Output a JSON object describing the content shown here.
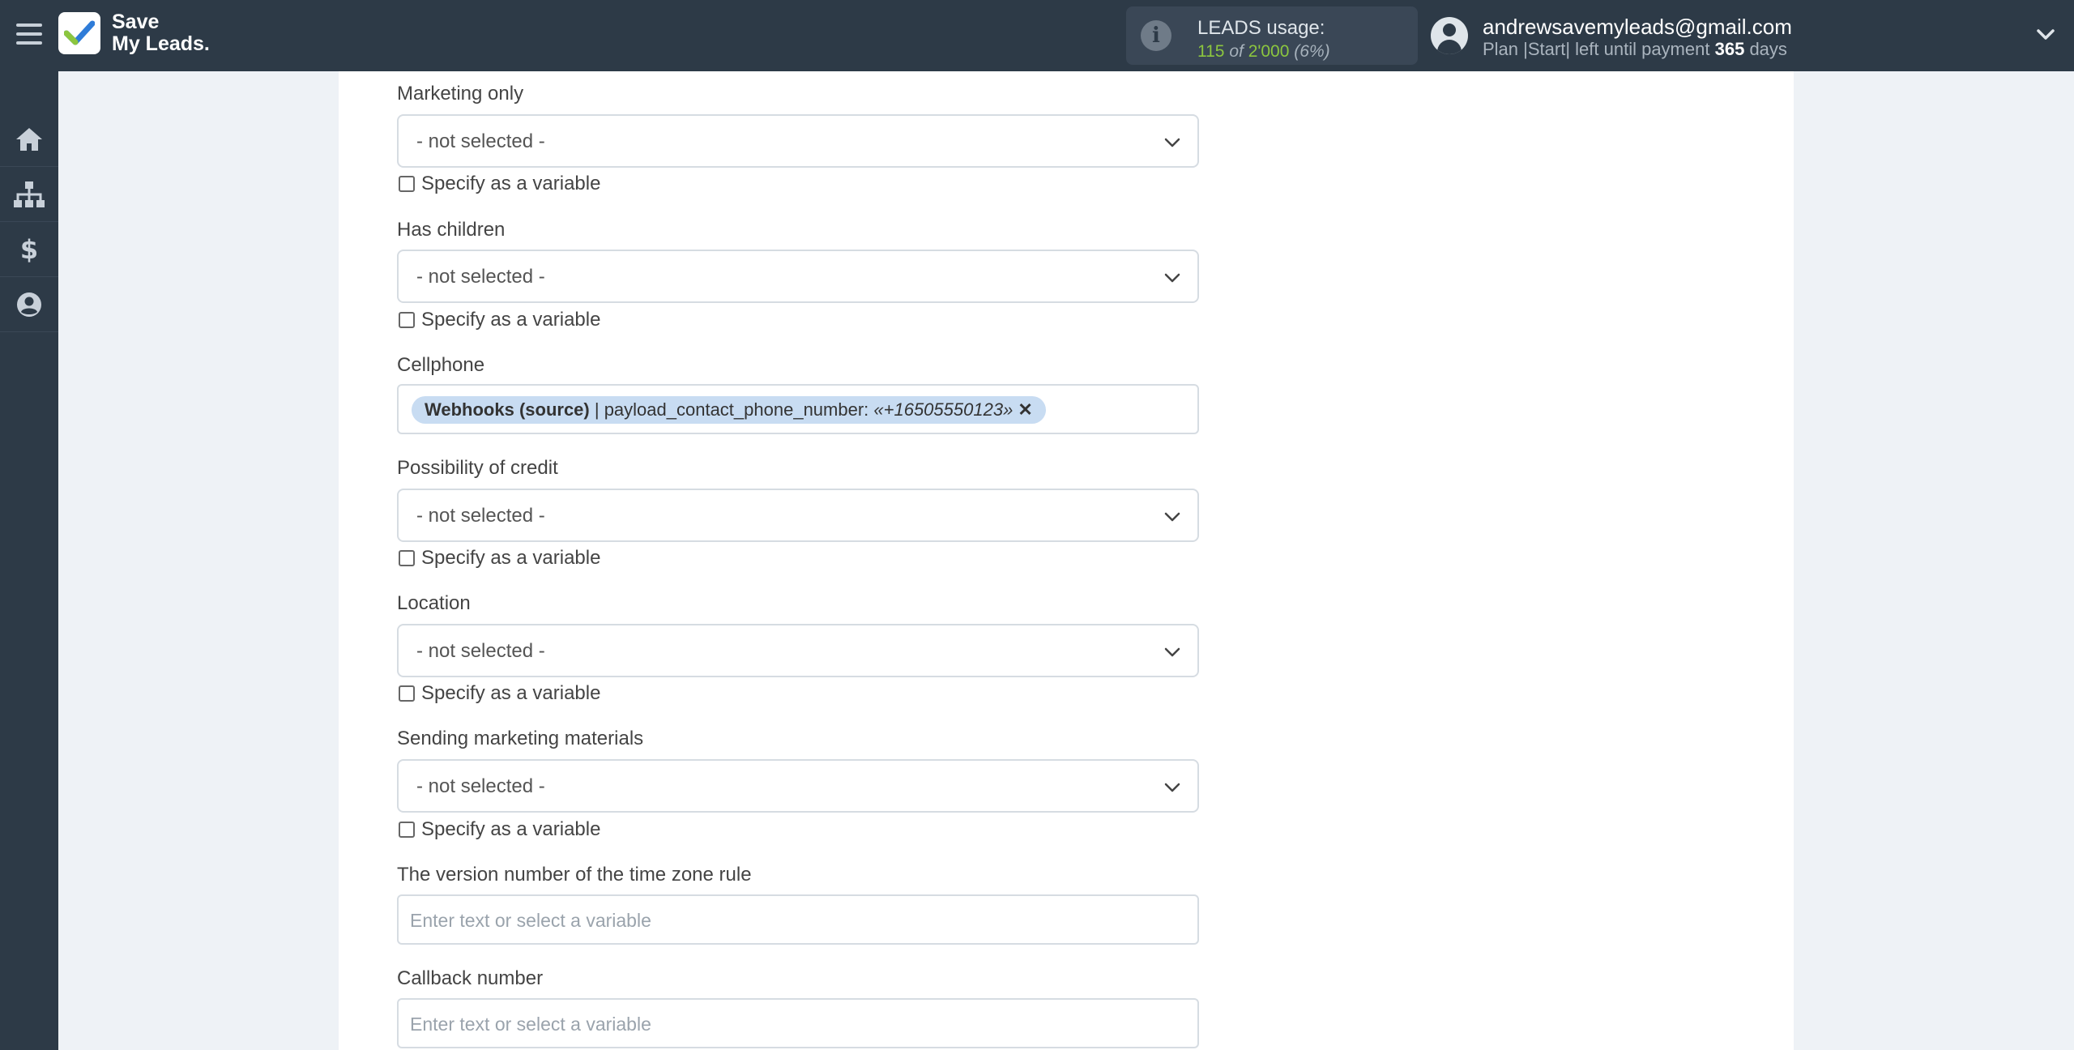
{
  "header": {
    "logo_line1": "Save",
    "logo_line2": "My Leads.",
    "usage_title": "LEADS usage:",
    "usage_used": "115",
    "usage_of": "of",
    "usage_total": "2'000",
    "usage_pct": "(6%)",
    "email": "andrewsavemyleads@gmail.com",
    "plan_prefix": "Plan |Start| left until payment",
    "plan_days": "365",
    "plan_suffix": "days"
  },
  "sidebar": {
    "items": [
      {
        "icon": "home-icon"
      },
      {
        "icon": "sitemap-icon"
      },
      {
        "icon": "dollar-icon"
      },
      {
        "icon": "user-circle-icon"
      }
    ]
  },
  "form": {
    "checkbox_label": "Specify as a variable",
    "not_selected": "- not selected -",
    "input_placeholder": "Enter text or select a variable",
    "marketing_only_label": "Marketing only",
    "has_children_label": "Has children",
    "cellphone_label": "Cellphone",
    "cellphone_tag": {
      "source": "Webhooks (source)",
      "separator": " | payload_contact_phone_number: ",
      "value": "«+16505550123»",
      "remove": "✕"
    },
    "credit_label": "Possibility of credit",
    "location_label": "Location",
    "marketing_materials_label": "Sending marketing materials",
    "timezone_label": "The version number of the time zone rule",
    "callback_label": "Callback number"
  },
  "colors": {
    "topbar": "#2d3a47",
    "accent_green": "#8cc63f",
    "tag_bg": "#c8dcf2"
  }
}
